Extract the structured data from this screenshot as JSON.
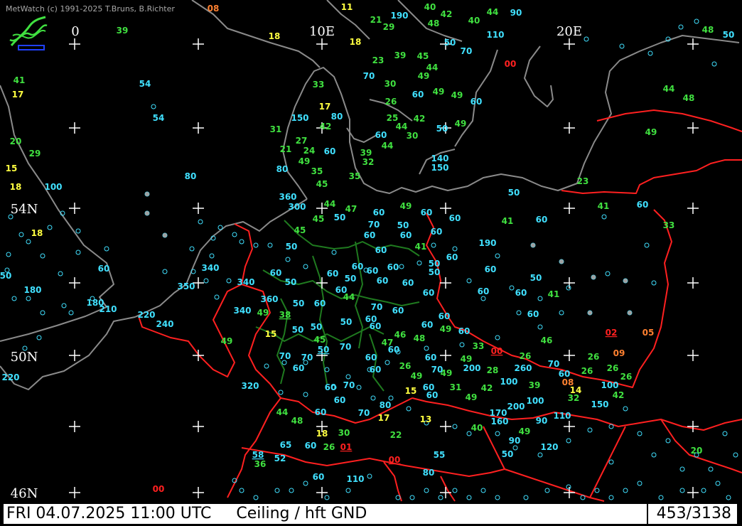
{
  "copyright": "MetWatch  (c) 1991-2025 T.Bruns, B.Richter",
  "colors": {
    "background": "#000000",
    "coast": "#8a8a8a",
    "border": "#ff2020",
    "state_border": "#1f7a1f",
    "grid": "#ffffff",
    "cyan": "#40e0ff",
    "green": "#40e040",
    "yellow": "#ffff40",
    "orange": "#ff8030",
    "red": "#ff2020"
  },
  "grid_labels": {
    "lon": [
      "0",
      "10E",
      "20E"
    ],
    "lat": [
      "54N",
      "50N",
      "46N"
    ]
  },
  "status": {
    "datetime": "FRI 04.07.2025 11:00 UTC",
    "parameter": "Ceiling / hft GND",
    "count": "453/3138"
  },
  "observations": [
    {
      "v": "08",
      "c": "orange"
    },
    {
      "v": "11",
      "c": "yellow"
    },
    {
      "v": "39",
      "c": "green"
    },
    {
      "v": "21",
      "c": "green"
    },
    {
      "v": "190",
      "c": "cyan"
    },
    {
      "v": "29",
      "c": "green"
    },
    {
      "v": "40",
      "c": "green"
    },
    {
      "v": "42",
      "c": "green"
    },
    {
      "v": "48",
      "c": "green"
    },
    {
      "v": "40",
      "c": "green"
    },
    {
      "v": "44",
      "c": "green"
    },
    {
      "v": "90",
      "c": "cyan"
    },
    {
      "v": "110",
      "c": "cyan"
    },
    {
      "v": "48",
      "c": "green"
    },
    {
      "v": "50",
      "c": "cyan"
    },
    {
      "v": "18",
      "c": "yellow"
    },
    {
      "v": "18",
      "c": "yellow"
    },
    {
      "v": "50",
      "c": "cyan"
    },
    {
      "v": "70",
      "c": "cyan"
    },
    {
      "v": "23",
      "c": "green"
    },
    {
      "v": "39",
      "c": "green"
    },
    {
      "v": "45",
      "c": "green"
    },
    {
      "v": "44",
      "c": "green"
    },
    {
      "v": "49",
      "c": "green"
    },
    {
      "v": "00",
      "c": "red"
    },
    {
      "v": "41",
      "c": "green"
    },
    {
      "v": "17",
      "c": "yellow"
    },
    {
      "v": "54",
      "c": "cyan"
    },
    {
      "v": "33",
      "c": "green"
    },
    {
      "v": "70",
      "c": "cyan"
    },
    {
      "v": "30",
      "c": "green"
    },
    {
      "v": "60",
      "c": "cyan"
    },
    {
      "v": "49",
      "c": "green"
    },
    {
      "v": "49",
      "c": "green"
    },
    {
      "v": "60",
      "c": "cyan"
    },
    {
      "v": "44",
      "c": "green"
    },
    {
      "v": "48",
      "c": "green"
    },
    {
      "v": "54",
      "c": "cyan"
    },
    {
      "v": "150",
      "c": "cyan"
    },
    {
      "v": "17",
      "c": "yellow"
    },
    {
      "v": "80",
      "c": "cyan"
    },
    {
      "v": "26",
      "c": "green"
    },
    {
      "v": "25",
      "c": "green"
    },
    {
      "v": "42",
      "c": "green"
    },
    {
      "v": "44",
      "c": "green"
    },
    {
      "v": "30",
      "c": "green"
    },
    {
      "v": "50",
      "c": "cyan"
    },
    {
      "v": "49",
      "c": "green"
    },
    {
      "v": "49",
      "c": "green"
    },
    {
      "v": "31",
      "c": "green"
    },
    {
      "v": "42",
      "c": "green"
    },
    {
      "v": "60",
      "c": "cyan"
    },
    {
      "v": "44",
      "c": "green"
    },
    {
      "v": "20",
      "c": "green"
    },
    {
      "v": "29",
      "c": "green"
    },
    {
      "v": "27",
      "c": "green"
    },
    {
      "v": "21",
      "c": "green"
    },
    {
      "v": "24",
      "c": "green"
    },
    {
      "v": "60",
      "c": "cyan"
    },
    {
      "v": "39",
      "c": "green"
    },
    {
      "v": "32",
      "c": "green"
    },
    {
      "v": "140",
      "c": "cyan"
    },
    {
      "v": "150",
      "c": "cyan"
    },
    {
      "v": "15",
      "c": "yellow"
    },
    {
      "v": "49",
      "c": "green"
    },
    {
      "v": "80",
      "c": "cyan"
    },
    {
      "v": "35",
      "c": "green"
    },
    {
      "v": "35",
      "c": "green"
    },
    {
      "v": "80",
      "c": "cyan"
    },
    {
      "v": "23",
      "c": "green"
    },
    {
      "v": "18",
      "c": "yellow"
    },
    {
      "v": "100",
      "c": "cyan"
    },
    {
      "v": "45",
      "c": "green"
    },
    {
      "v": "50",
      "c": "cyan"
    },
    {
      "v": "360",
      "c": "cyan"
    },
    {
      "v": "300",
      "c": "cyan"
    },
    {
      "v": "44",
      "c": "green"
    },
    {
      "v": "47",
      "c": "green"
    },
    {
      "v": "60",
      "c": "cyan"
    },
    {
      "v": "49",
      "c": "green"
    },
    {
      "v": "60",
      "c": "cyan"
    },
    {
      "v": "41",
      "c": "green"
    },
    {
      "v": "60",
      "c": "cyan"
    },
    {
      "v": "45",
      "c": "green"
    },
    {
      "v": "50",
      "c": "cyan"
    },
    {
      "v": "60",
      "c": "cyan"
    },
    {
      "v": "41",
      "c": "green"
    },
    {
      "v": "60",
      "c": "cyan"
    },
    {
      "v": "33",
      "c": "green"
    },
    {
      "v": "18",
      "c": "yellow"
    },
    {
      "v": "45",
      "c": "green"
    },
    {
      "v": "70",
      "c": "cyan"
    },
    {
      "v": "50",
      "c": "cyan"
    },
    {
      "v": "60",
      "c": "cyan"
    },
    {
      "v": "60",
      "c": "cyan"
    },
    {
      "v": "60",
      "c": "cyan"
    },
    {
      "v": "50",
      "c": "cyan"
    },
    {
      "v": "60",
      "c": "cyan"
    },
    {
      "v": "41",
      "c": "green"
    },
    {
      "v": "60",
      "c": "cyan"
    },
    {
      "v": "190",
      "c": "cyan"
    },
    {
      "v": "60",
      "c": "cyan"
    },
    {
      "v": "340",
      "c": "cyan"
    },
    {
      "v": "60",
      "c": "cyan"
    },
    {
      "v": "50",
      "c": "cyan"
    },
    {
      "v": "60",
      "c": "cyan"
    },
    {
      "v": "60",
      "c": "cyan"
    },
    {
      "v": "60",
      "c": "cyan"
    },
    {
      "v": "60",
      "c": "cyan"
    },
    {
      "v": "50",
      "c": "cyan"
    },
    {
      "v": "60",
      "c": "cyan"
    },
    {
      "v": "50",
      "c": "cyan"
    },
    {
      "v": "350",
      "c": "cyan"
    },
    {
      "v": "50",
      "c": "cyan"
    },
    {
      "v": "340",
      "c": "cyan"
    },
    {
      "v": "50",
      "c": "cyan"
    },
    {
      "v": "60",
      "c": "cyan"
    },
    {
      "v": "60",
      "c": "cyan"
    },
    {
      "v": "50",
      "c": "cyan"
    },
    {
      "v": "180",
      "c": "cyan"
    },
    {
      "v": "60",
      "c": "cyan"
    },
    {
      "v": "44",
      "c": "green"
    },
    {
      "v": "60",
      "c": "cyan"
    },
    {
      "v": "60",
      "c": "cyan"
    },
    {
      "v": "60",
      "c": "cyan"
    },
    {
      "v": "41",
      "c": "green"
    },
    {
      "v": "180",
      "c": "cyan"
    },
    {
      "v": "210",
      "c": "cyan"
    },
    {
      "v": "360",
      "c": "cyan"
    },
    {
      "v": "50",
      "c": "cyan"
    },
    {
      "v": "60",
      "c": "cyan"
    },
    {
      "v": "70",
      "c": "cyan"
    },
    {
      "v": "60",
      "c": "cyan"
    },
    {
      "v": "340",
      "c": "cyan"
    },
    {
      "v": "49",
      "c": "green"
    },
    {
      "v": "38",
      "c": "green",
      "u": true
    },
    {
      "v": "50",
      "c": "cyan"
    },
    {
      "v": "60",
      "c": "cyan"
    },
    {
      "v": "220",
      "c": "cyan"
    },
    {
      "v": "240",
      "c": "cyan"
    },
    {
      "v": "60",
      "c": "cyan"
    },
    {
      "v": "60",
      "c": "cyan"
    },
    {
      "v": "50",
      "c": "cyan"
    },
    {
      "v": "50",
      "c": "cyan"
    },
    {
      "v": "60",
      "c": "cyan"
    },
    {
      "v": "60",
      "c": "cyan"
    },
    {
      "v": "49",
      "c": "green"
    },
    {
      "v": "60",
      "c": "cyan"
    },
    {
      "v": "02",
      "c": "red",
      "u": true
    },
    {
      "v": "05",
      "c": "orange"
    },
    {
      "v": "15",
      "c": "yellow"
    },
    {
      "v": "46",
      "c": "green"
    },
    {
      "v": "48",
      "c": "green"
    },
    {
      "v": "45",
      "c": "green"
    },
    {
      "v": "50",
      "c": "cyan",
      "u": true
    },
    {
      "v": "70",
      "c": "cyan"
    },
    {
      "v": "47",
      "c": "green"
    },
    {
      "v": "60",
      "c": "cyan"
    },
    {
      "v": "33",
      "c": "green"
    },
    {
      "v": "46",
      "c": "green"
    },
    {
      "v": "49",
      "c": "green"
    },
    {
      "v": "70",
      "c": "cyan"
    },
    {
      "v": "70",
      "c": "cyan"
    },
    {
      "v": "00",
      "c": "red",
      "u": true
    },
    {
      "v": "26",
      "c": "green"
    },
    {
      "v": "09",
      "c": "orange"
    },
    {
      "v": "70",
      "c": "cyan"
    },
    {
      "v": "60",
      "c": "cyan"
    },
    {
      "v": "60",
      "c": "cyan"
    },
    {
      "v": "60",
      "c": "cyan"
    },
    {
      "v": "26",
      "c": "green"
    },
    {
      "v": "49",
      "c": "green"
    },
    {
      "v": "26",
      "c": "green"
    },
    {
      "v": "60",
      "c": "cyan"
    },
    {
      "v": "70",
      "c": "cyan"
    },
    {
      "v": "49",
      "c": "green"
    },
    {
      "v": "200",
      "c": "cyan"
    },
    {
      "v": "28",
      "c": "green"
    },
    {
      "v": "260",
      "c": "cyan"
    },
    {
      "v": "26",
      "c": "green"
    },
    {
      "v": "26",
      "c": "green"
    },
    {
      "v": "220",
      "c": "cyan"
    },
    {
      "v": "60",
      "c": "cyan"
    },
    {
      "v": "49",
      "c": "green"
    },
    {
      "v": "26",
      "c": "green"
    },
    {
      "v": "31",
      "c": "green"
    },
    {
      "v": "100",
      "c": "cyan"
    },
    {
      "v": "08",
      "c": "orange"
    },
    {
      "v": "320",
      "c": "cyan"
    },
    {
      "v": "60",
      "c": "cyan"
    },
    {
      "v": "70",
      "c": "cyan"
    },
    {
      "v": "15",
      "c": "yellow"
    },
    {
      "v": "60",
      "c": "cyan"
    },
    {
      "v": "42",
      "c": "green"
    },
    {
      "v": "39",
      "c": "green"
    },
    {
      "v": "14",
      "c": "yellow"
    },
    {
      "v": "100",
      "c": "cyan"
    },
    {
      "v": "60",
      "c": "cyan"
    },
    {
      "v": "80",
      "c": "cyan"
    },
    {
      "v": "49",
      "c": "green"
    },
    {
      "v": "32",
      "c": "green"
    },
    {
      "v": "42",
      "c": "green"
    },
    {
      "v": "44",
      "c": "green"
    },
    {
      "v": "60",
      "c": "cyan"
    },
    {
      "v": "70",
      "c": "cyan"
    },
    {
      "v": "200",
      "c": "cyan"
    },
    {
      "v": "100",
      "c": "cyan"
    },
    {
      "v": "150",
      "c": "cyan"
    },
    {
      "v": "48",
      "c": "green"
    },
    {
      "v": "17",
      "c": "yellow"
    },
    {
      "v": "13",
      "c": "yellow"
    },
    {
      "v": "60",
      "c": "cyan"
    },
    {
      "v": "170",
      "c": "cyan"
    },
    {
      "v": "110",
      "c": "cyan"
    },
    {
      "v": "160",
      "c": "cyan"
    },
    {
      "v": "90",
      "c": "cyan"
    },
    {
      "v": "18",
      "c": "yellow"
    },
    {
      "v": "30",
      "c": "green"
    },
    {
      "v": "22",
      "c": "green"
    },
    {
      "v": "40",
      "c": "green"
    },
    {
      "v": "49",
      "c": "green"
    },
    {
      "v": "65",
      "c": "cyan"
    },
    {
      "v": "60",
      "c": "cyan"
    },
    {
      "v": "26",
      "c": "green"
    },
    {
      "v": "01",
      "c": "red",
      "u": true
    },
    {
      "v": "90",
      "c": "cyan"
    },
    {
      "v": "120",
      "c": "cyan"
    },
    {
      "v": "20",
      "c": "green"
    },
    {
      "v": "58",
      "c": "cyan",
      "u": true
    },
    {
      "v": "52",
      "c": "cyan"
    },
    {
      "v": "55",
      "c": "cyan"
    },
    {
      "v": "50",
      "c": "cyan"
    },
    {
      "v": "36",
      "c": "green"
    },
    {
      "v": "00",
      "c": "red",
      "u": true
    },
    {
      "v": "80",
      "c": "cyan"
    },
    {
      "v": "60",
      "c": "cyan"
    },
    {
      "v": "110",
      "c": "cyan"
    },
    {
      "v": "00",
      "c": "red"
    }
  ]
}
